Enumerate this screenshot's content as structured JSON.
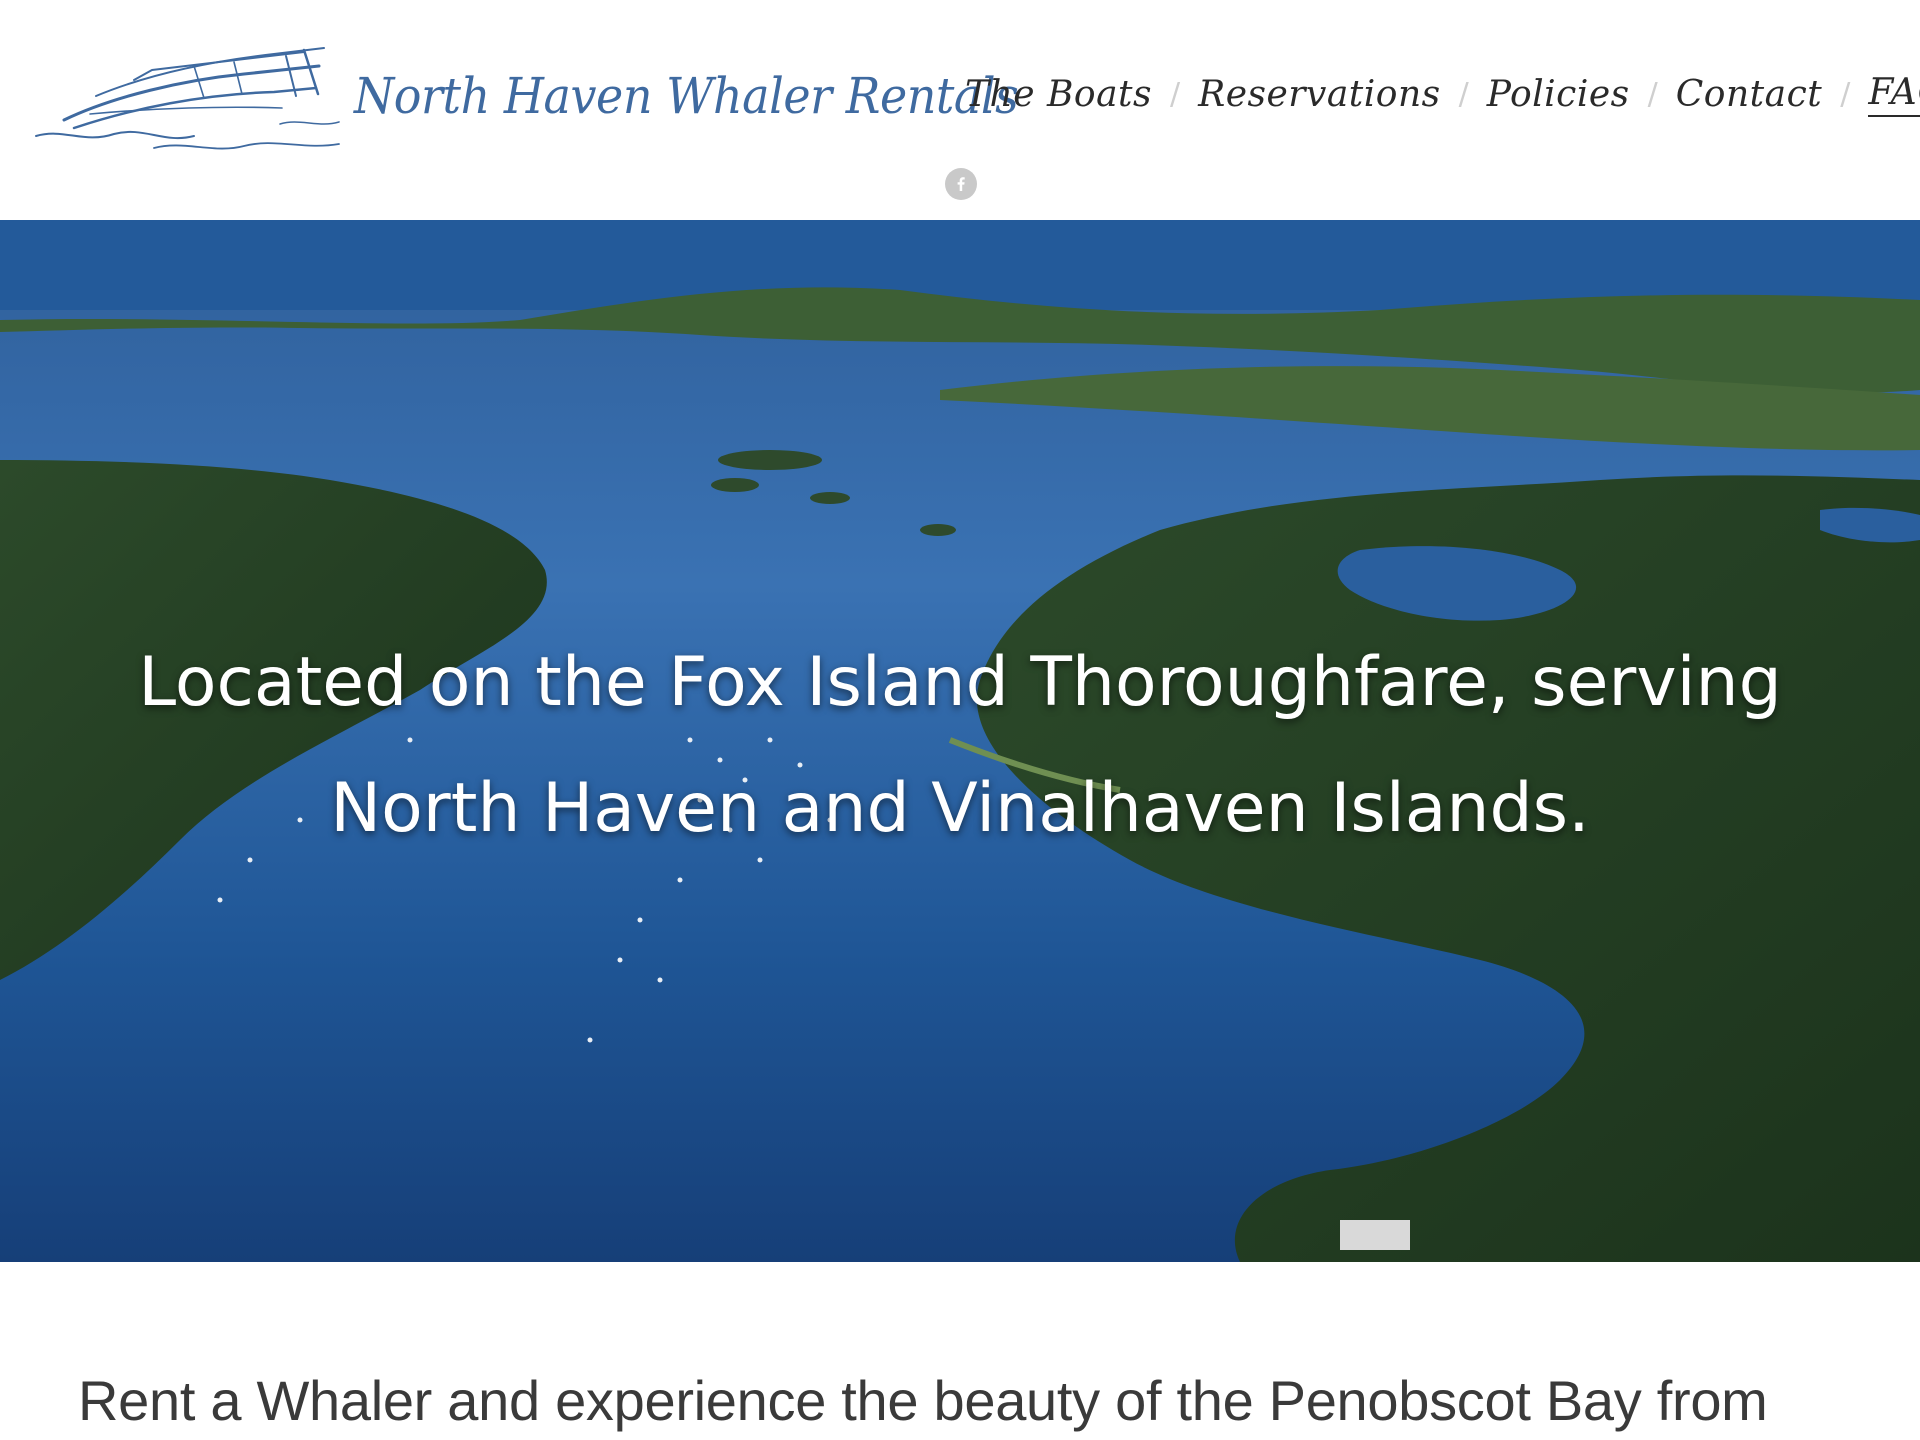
{
  "site": {
    "brand": "North Haven Whaler Rentals",
    "brand_color": "#3f6aa0"
  },
  "nav": {
    "items": [
      {
        "label": "The Boats"
      },
      {
        "label": "Reservations"
      },
      {
        "label": "Policies"
      },
      {
        "label": "Contact"
      },
      {
        "label": "FAQ"
      }
    ],
    "separator": "/"
  },
  "social": {
    "facebook_icon": "facebook-icon",
    "facebook_glyph": "f"
  },
  "hero": {
    "background": "aerial photo of islands and bay",
    "headline": "Located on the Fox Island Thoroughfare, serving North Haven and Vinalhaven Islands."
  },
  "intro": {
    "text": "Rent a Whaler and experience the beauty of the Penobscot Bay from"
  }
}
